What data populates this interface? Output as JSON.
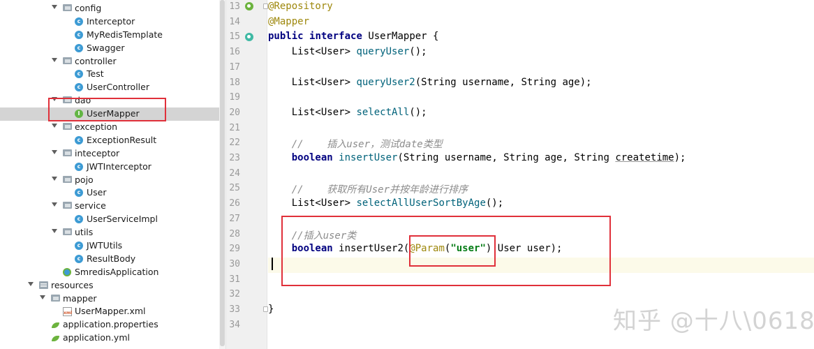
{
  "project_tree": {
    "items": [
      {
        "label": "config",
        "icon": "folder-icon",
        "indent": 1,
        "expanded": true
      },
      {
        "label": "Interceptor",
        "icon": "class-icon",
        "indent": 2
      },
      {
        "label": "MyRedisTemplate",
        "icon": "class-icon",
        "indent": 2
      },
      {
        "label": "Swagger",
        "icon": "class-icon",
        "indent": 2
      },
      {
        "label": "controller",
        "icon": "folder-icon",
        "indent": 1,
        "expanded": true
      },
      {
        "label": "Test",
        "icon": "class-icon",
        "indent": 2
      },
      {
        "label": "UserController",
        "icon": "class-icon",
        "indent": 2
      },
      {
        "label": "dao",
        "icon": "folder-icon",
        "indent": 1,
        "expanded": true
      },
      {
        "label": "UserMapper",
        "icon": "interface-icon",
        "indent": 2,
        "selected": true
      },
      {
        "label": "exception",
        "icon": "folder-icon",
        "indent": 1,
        "expanded": true
      },
      {
        "label": "ExceptionResult",
        "icon": "class-icon",
        "indent": 2
      },
      {
        "label": "inteceptor",
        "icon": "folder-icon",
        "indent": 1,
        "expanded": true
      },
      {
        "label": "JWTInterceptor",
        "icon": "class-icon",
        "indent": 2
      },
      {
        "label": "pojo",
        "icon": "folder-icon",
        "indent": 1,
        "expanded": true
      },
      {
        "label": "User",
        "icon": "class-icon",
        "indent": 2
      },
      {
        "label": "service",
        "icon": "folder-icon",
        "indent": 1,
        "expanded": true
      },
      {
        "label": "UserServiceImpl",
        "icon": "class-icon",
        "indent": 2
      },
      {
        "label": "utils",
        "icon": "folder-icon",
        "indent": 1,
        "expanded": true
      },
      {
        "label": "JWTUtils",
        "icon": "class-icon",
        "indent": 2
      },
      {
        "label": "ResultBody",
        "icon": "class-icon",
        "indent": 2
      },
      {
        "label": "SmredisApplication",
        "icon": "spring-boot-class-icon",
        "indent": 1
      },
      {
        "label": "resources",
        "icon": "resources-folder-icon",
        "indent": -1,
        "expanded": true
      },
      {
        "label": "mapper",
        "icon": "folder-icon",
        "indent": 0,
        "expanded": true
      },
      {
        "label": "UserMapper.xml",
        "icon": "xml-file-icon",
        "indent": 1
      },
      {
        "label": "application.properties",
        "icon": "spring-config-icon",
        "indent": 0
      },
      {
        "label": "application.yml",
        "icon": "spring-config-icon",
        "indent": 0
      }
    ]
  },
  "editor": {
    "lines": [
      {
        "no": "13",
        "tokens": [
          {
            "t": "@Repository",
            "c": "ann"
          }
        ]
      },
      {
        "no": "14",
        "tokens": [
          {
            "t": "@Mapper",
            "c": "ann"
          }
        ]
      },
      {
        "no": "15",
        "tokens": [
          {
            "t": "public ",
            "c": "kw"
          },
          {
            "t": "interface ",
            "c": "kw"
          },
          {
            "t": "UserMapper {",
            "c": ""
          }
        ]
      },
      {
        "no": "16",
        "tokens": [
          {
            "t": "    List<User> ",
            "c": ""
          },
          {
            "t": "queryUser",
            "c": "meth"
          },
          {
            "t": "();",
            "c": ""
          }
        ]
      },
      {
        "no": "17",
        "tokens": []
      },
      {
        "no": "18",
        "tokens": [
          {
            "t": "    List<User> ",
            "c": ""
          },
          {
            "t": "queryUser2",
            "c": "meth"
          },
          {
            "t": "(String username, String age);",
            "c": ""
          }
        ]
      },
      {
        "no": "19",
        "tokens": []
      },
      {
        "no": "20",
        "tokens": [
          {
            "t": "    List<User> ",
            "c": ""
          },
          {
            "t": "selectAll",
            "c": "meth"
          },
          {
            "t": "();",
            "c": ""
          }
        ]
      },
      {
        "no": "21",
        "tokens": []
      },
      {
        "no": "22",
        "tokens": [
          {
            "t": "    //    插入user，测试date类型",
            "c": "cmt"
          }
        ]
      },
      {
        "no": "23",
        "tokens": [
          {
            "t": "    boolean ",
            "c": "kw"
          },
          {
            "t": "insertUser",
            "c": "meth"
          },
          {
            "t": "(String username, String age, String ",
            "c": ""
          },
          {
            "t": "createtime",
            "c": "ul"
          },
          {
            "t": ");",
            "c": ""
          }
        ]
      },
      {
        "no": "24",
        "tokens": []
      },
      {
        "no": "25",
        "tokens": [
          {
            "t": "    //    获取所有User并按年龄进行排序",
            "c": "cmt"
          }
        ]
      },
      {
        "no": "26",
        "tokens": [
          {
            "t": "    List<User> ",
            "c": ""
          },
          {
            "t": "selectAllUserSortByAge",
            "c": "meth"
          },
          {
            "t": "();",
            "c": ""
          }
        ]
      },
      {
        "no": "27",
        "tokens": []
      },
      {
        "no": "28",
        "tokens": [
          {
            "t": "    //插入user类",
            "c": "cmt"
          }
        ]
      },
      {
        "no": "29",
        "tokens": [
          {
            "t": "    boolean ",
            "c": "kw"
          },
          {
            "t": "insertUser2",
            "c": ""
          },
          {
            "t": "(",
            "c": ""
          },
          {
            "t": "@Param",
            "c": "ann"
          },
          {
            "t": "(",
            "c": ""
          },
          {
            "t": "\"user\"",
            "c": "str"
          },
          {
            "t": ") User user);",
            "c": ""
          }
        ]
      },
      {
        "no": "30",
        "tokens": [],
        "current": true
      },
      {
        "no": "31",
        "tokens": []
      },
      {
        "no": "32",
        "tokens": []
      },
      {
        "no": "33",
        "tokens": [
          {
            "t": "}",
            "c": ""
          }
        ]
      },
      {
        "no": "34",
        "tokens": []
      }
    ]
  },
  "watermark": "知乎 @十八\\0618",
  "colors": {
    "highlight_box": "#e0303a",
    "annotation": "#9e880d",
    "keyword": "#000080",
    "method": "#00627a",
    "comment": "#8c8c8c",
    "string": "#067d17",
    "selection": "#d4d4d4",
    "current_line": "#fcfae9"
  }
}
